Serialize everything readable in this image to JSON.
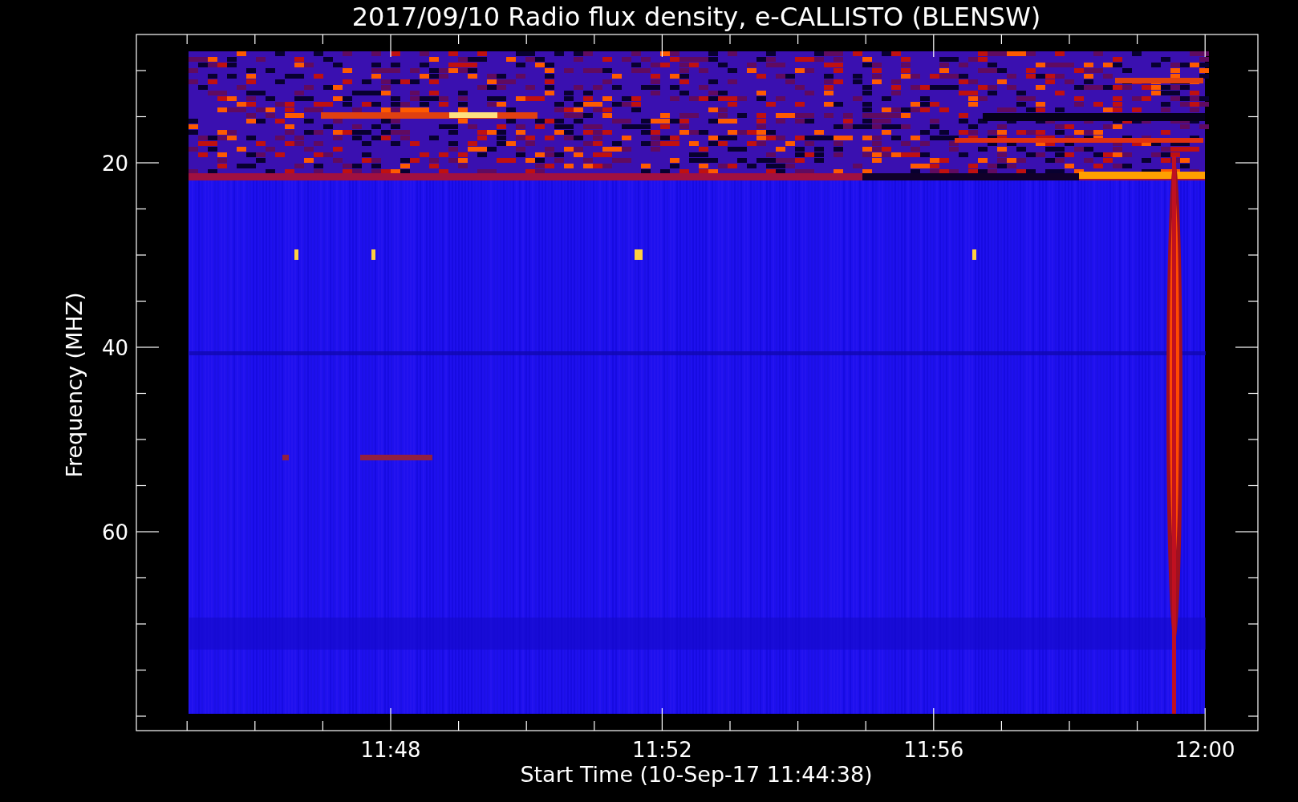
{
  "title": "2017/09/10  Radio flux density, e-CALLISTO (BLENSW)",
  "plot": {
    "ylabel": "Frequency (MHZ)",
    "xlabel": "Start Time (10-Sep-17 11:44:38)",
    "yticks": [
      "20",
      "40",
      "60"
    ],
    "xticks": [
      "11:48",
      "11:52",
      "11:56",
      "12:00"
    ]
  }
}
